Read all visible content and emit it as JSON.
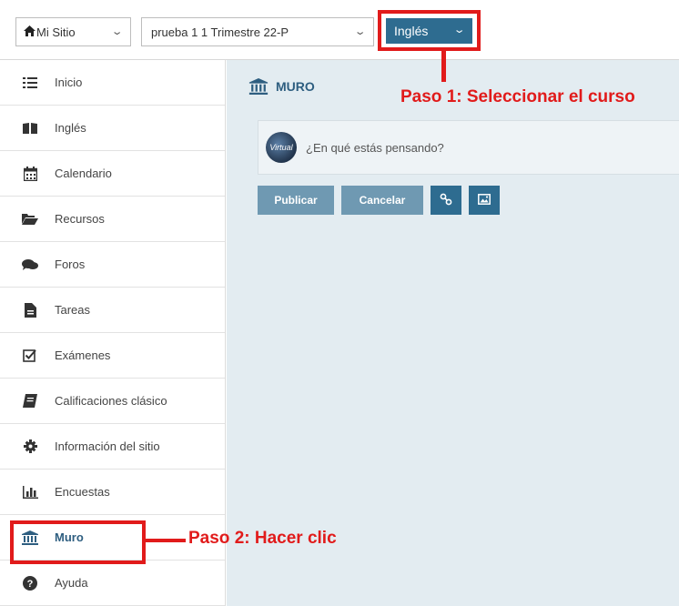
{
  "header": {
    "site_select": {
      "label": "Mi Sitio",
      "icon": "home-icon"
    },
    "course_select": {
      "label": "prueba 1 1 Trimestre 22-P"
    },
    "subject_select": {
      "label": "Inglés"
    }
  },
  "sidebar": {
    "items": [
      {
        "label": "Inicio",
        "icon": "list-icon"
      },
      {
        "label": "Inglés",
        "icon": "book-icon"
      },
      {
        "label": "Calendario",
        "icon": "calendar-icon"
      },
      {
        "label": "Recursos",
        "icon": "folder-open-icon"
      },
      {
        "label": "Foros",
        "icon": "comments-icon"
      },
      {
        "label": "Tareas",
        "icon": "file-icon"
      },
      {
        "label": "Exámenes",
        "icon": "check-square-icon"
      },
      {
        "label": "Calificaciones clásico",
        "icon": "gradebook-icon"
      },
      {
        "label": "Información del sitio",
        "icon": "cog-icon"
      },
      {
        "label": "Encuestas",
        "icon": "bar-chart-icon"
      },
      {
        "label": "Muro",
        "icon": "institution-icon",
        "active": true
      },
      {
        "label": "Ayuda",
        "icon": "question-circle-icon"
      }
    ]
  },
  "main": {
    "title": "MURO",
    "post": {
      "placeholder": "¿En qué estás pensando?",
      "avatar_text": "Virtual"
    },
    "buttons": {
      "publish": "Publicar",
      "cancel": "Cancelar",
      "link_icon": "link-icon",
      "image_icon": "image-icon"
    }
  },
  "annotations": {
    "step1": "Paso 1: Seleccionar el curso",
    "step2": "Paso 2: Hacer clic"
  },
  "colors": {
    "accent": "#2e6c90",
    "button_light": "#6f99b2",
    "annotation_red": "#e11b1b",
    "main_bg": "#e3ecf1"
  }
}
